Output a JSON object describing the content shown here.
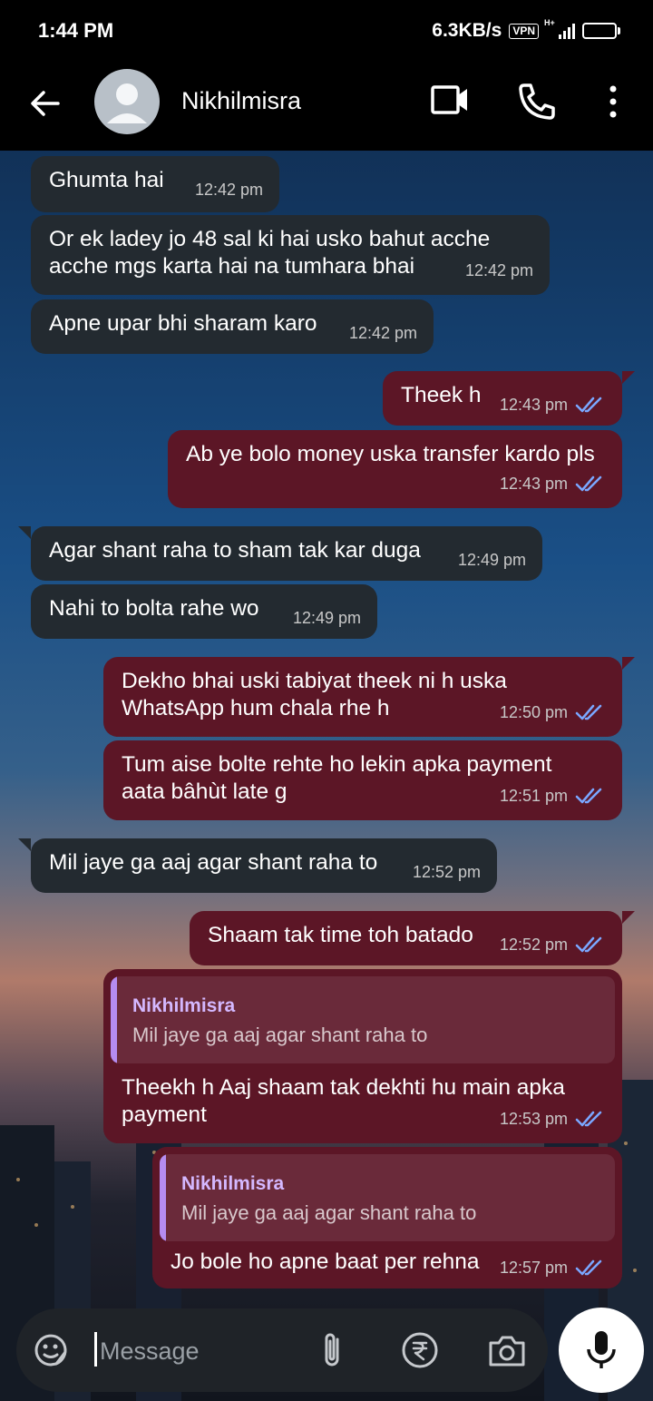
{
  "status_bar": {
    "time": "1:44 PM",
    "network_speed": "6.3KB/s",
    "vpn": "VPN",
    "network_type": "H+",
    "battery_level": "82"
  },
  "header": {
    "contact_name": "Nikhilmisra"
  },
  "messages": [
    {
      "type": "in",
      "text": "Ghumta hai",
      "time": "12:42 pm"
    },
    {
      "type": "in",
      "text": "Or ek ladey jo 48 sal ki hai usko bahut acche acche mgs karta hai na tumhara bhai",
      "time": "12:42 pm"
    },
    {
      "type": "in",
      "text": "Apne upar bhi sharam karo",
      "time": "12:42 pm"
    },
    {
      "type": "out",
      "text": "Theek h",
      "time": "12:43 pm"
    },
    {
      "type": "out",
      "text": "Ab ye bolo money uska transfer kardo pls",
      "time": "12:43 pm"
    },
    {
      "type": "in",
      "text": "Agar shant raha to sham tak kar duga",
      "time": "12:49 pm"
    },
    {
      "type": "in",
      "text": "Nahi to bolta rahe wo",
      "time": "12:49 pm"
    },
    {
      "type": "out",
      "text": "Dekho bhai uski tabiyat theek ni h uska WhatsApp hum chala rhe h",
      "time": "12:50 pm"
    },
    {
      "type": "out",
      "text": "Tum aise bolte rehte ho lekin apka payment aata bâhùt late g",
      "time": "12:51 pm"
    },
    {
      "type": "in",
      "text": "Mil jaye ga aaj agar shant raha to",
      "time": "12:52 pm"
    },
    {
      "type": "out",
      "text": "Shaam tak time toh batado",
      "time": "12:52 pm"
    },
    {
      "type": "out",
      "text": "Theekh h Aaj shaam tak dekhti hu main apka payment",
      "time": "12:53 pm",
      "quote": {
        "name": "Nikhilmisra",
        "text": "Mil jaye ga aaj agar shant raha to"
      }
    },
    {
      "type": "out",
      "text": "Jo bole ho apne baat per rehna",
      "time": "12:57 pm",
      "quote": {
        "name": "Nikhilmisra",
        "text": "Mil jaye ga aaj agar shant raha to"
      }
    }
  ],
  "composer": {
    "placeholder": "Message"
  },
  "colors": {
    "incoming_bubble": "#232a30",
    "outgoing_bubble": "#5c1626",
    "read_tick": "#7aa7ff",
    "quote_accent": "#b58cf0"
  }
}
